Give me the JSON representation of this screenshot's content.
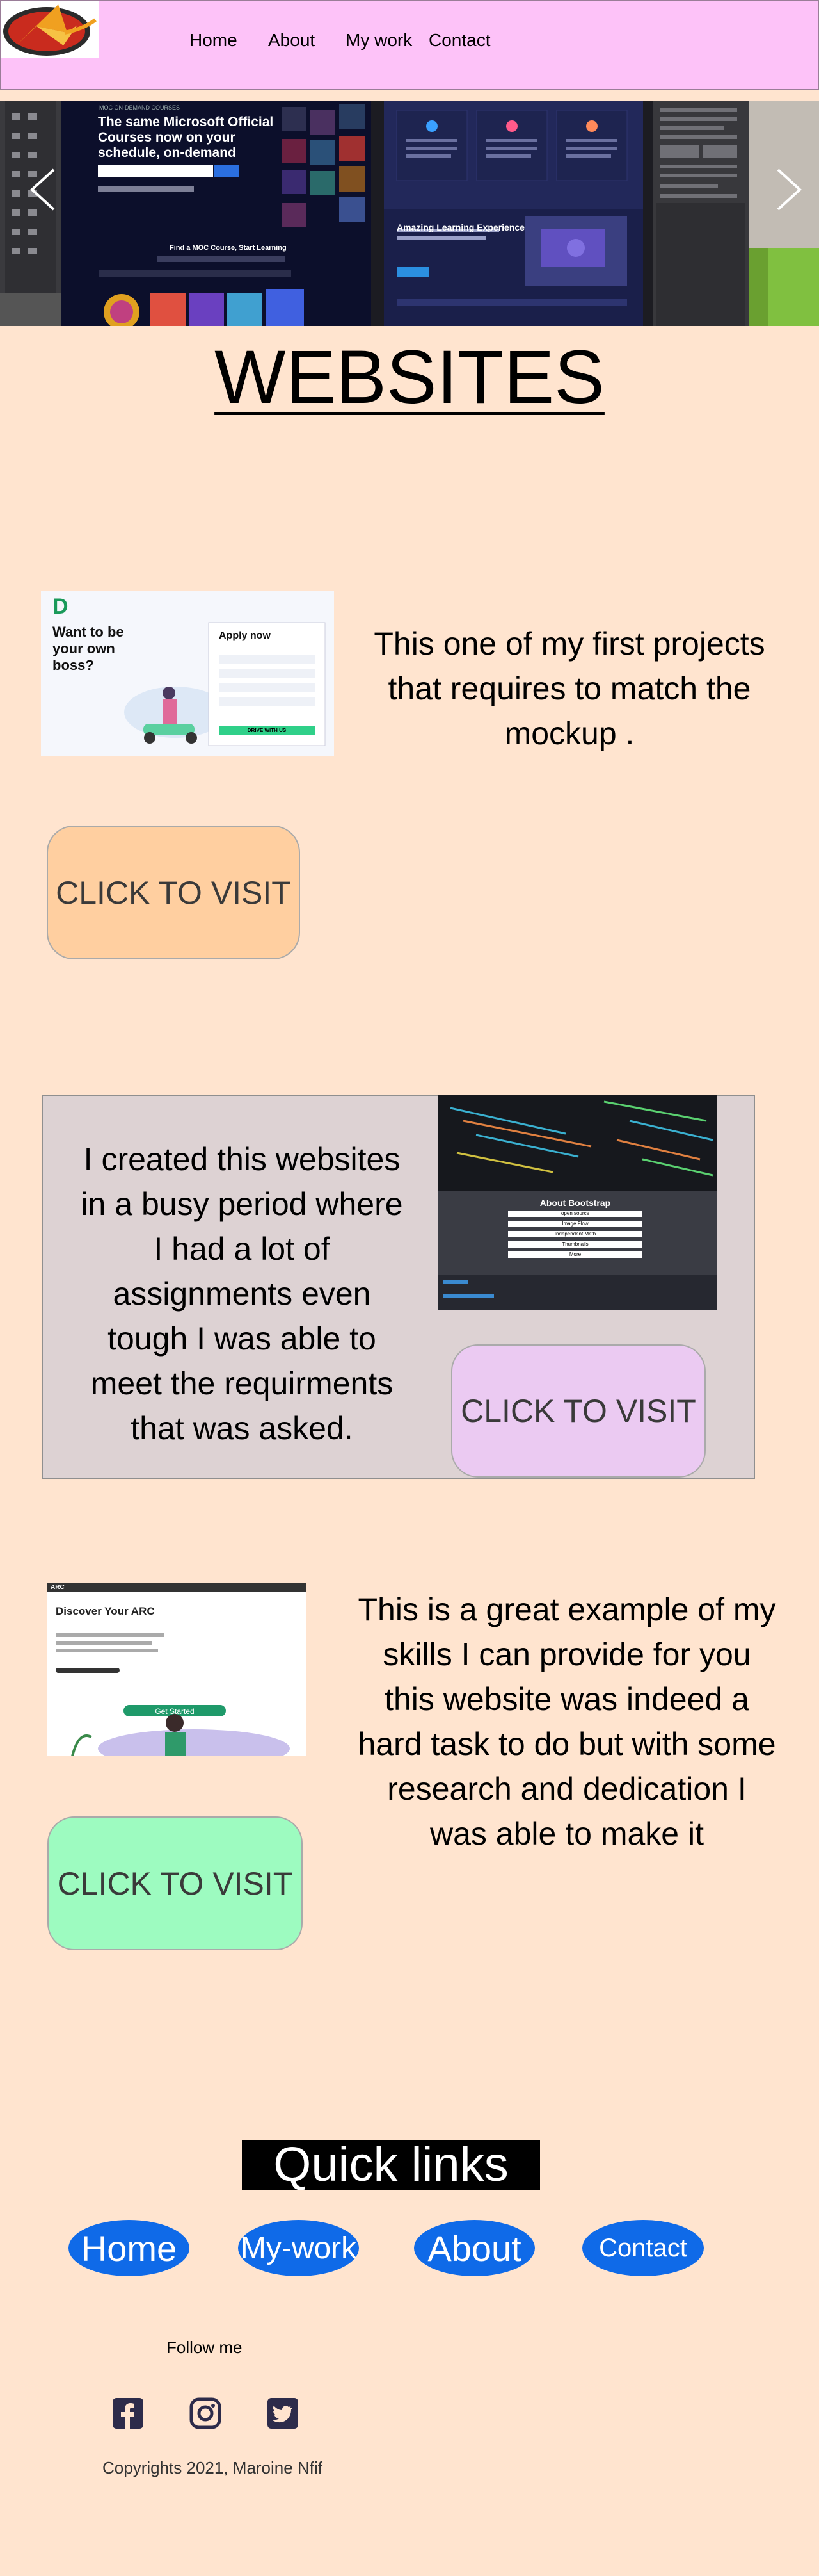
{
  "nav": {
    "links": [
      "Home",
      "About",
      "My work",
      "Contact"
    ]
  },
  "carousel": {
    "prev_icon": "chevron-left-icon",
    "next_icon": "chevron-right-icon",
    "slide1": {
      "tag": "MOC ON-DEMAND COURSES",
      "headline": "The same Microsoft Official Courses now on your schedule, on-demand",
      "cta": "Find a MOC Course, Start Learning"
    },
    "slide2": {
      "heading": "Amazing Learning Experience"
    }
  },
  "page_title": "WEBSITES",
  "projects": [
    {
      "description": "This one of my first projects that requires to match the mockup .",
      "button": "CLICK TO VISIT",
      "thumb": {
        "headline": "Want to be your own boss?",
        "form_title": "Apply now",
        "form_button": "DRIVE WITH US"
      }
    },
    {
      "description": "I created this websites in a busy period where I had a lot of assignments even tough I was able to meet the requirments that was asked.",
      "button": "CLICK TO VISIT",
      "thumb": {
        "heading": "About Bootstrap",
        "rows": [
          "open source",
          "Image Flow",
          "Independent Meth",
          "Thumbnails",
          "More"
        ]
      }
    },
    {
      "description": "This is a great example of my skills I can provide for you this website was indeed a hard task to do but with some research and dedication I was able to make it",
      "button": "CLICK TO VISIT",
      "thumb": {
        "brand": "ARC",
        "headline": "Discover Your ARC",
        "cta": "Get Started"
      }
    }
  ],
  "quick_links": {
    "title": "Quick links",
    "links": [
      "Home",
      "My-work",
      "About",
      "Contact"
    ]
  },
  "footer": {
    "follow": "Follow me",
    "social_icons": [
      "facebook-icon",
      "instagram-icon",
      "twitter-icon"
    ],
    "copyright": "Copyrights 2021, Maroine Nfif"
  },
  "colors": {
    "background": "#ffe4cf",
    "header": "#fdc2f8",
    "button1": "#ffcfa0",
    "button2": "#ebcaf2",
    "button3": "#9dfbc0",
    "quick_link": "#0f6ae8"
  }
}
